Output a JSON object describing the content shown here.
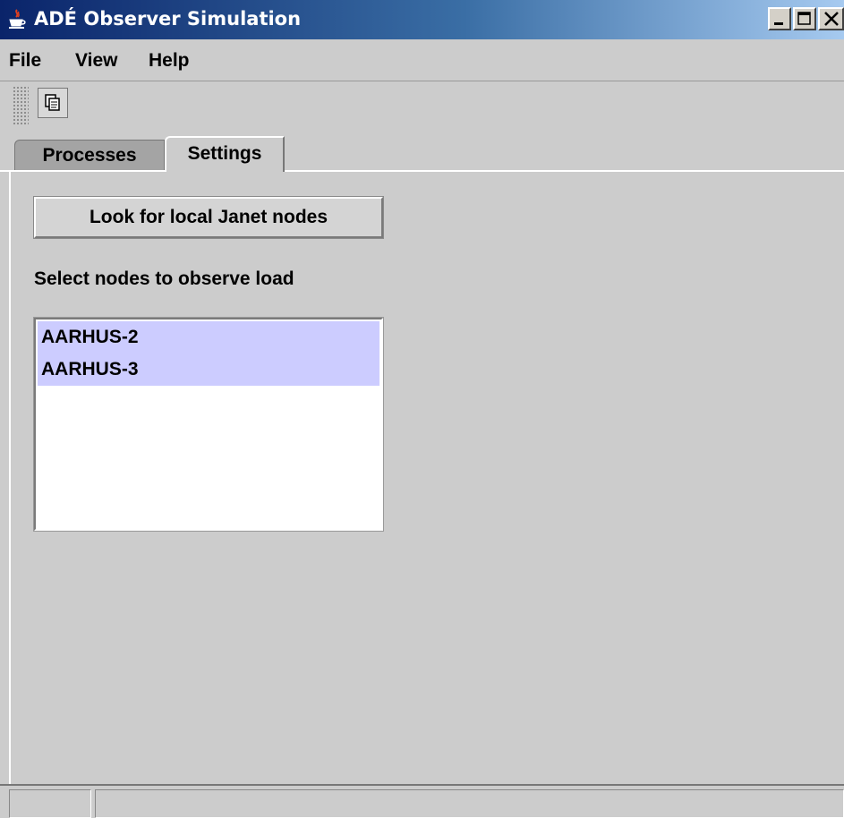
{
  "window": {
    "title": "ADÉ Observer Simulation",
    "controls": {
      "minimize_icon": "minimize-icon",
      "maximize_icon": "maximize-icon",
      "close_icon": "close-icon"
    },
    "title_bar_colors": [
      "#0a246a",
      "#a6caf0"
    ]
  },
  "menu": {
    "items": [
      {
        "label": "File"
      },
      {
        "label": "View"
      },
      {
        "label": "Help"
      }
    ]
  },
  "toolbar": {
    "buttons": [
      {
        "icon": "copy-icon"
      }
    ]
  },
  "tabs": [
    {
      "label": "Processes",
      "selected": false
    },
    {
      "label": "Settings",
      "selected": true
    }
  ],
  "settings": {
    "look_button_label": "Look for local Janet nodes",
    "select_label": "Select nodes to observe load",
    "nodes": [
      {
        "label": "AARHUS-2",
        "selected": true
      },
      {
        "label": "AARHUS-3",
        "selected": true
      }
    ],
    "selection_color": "#ccccff"
  }
}
